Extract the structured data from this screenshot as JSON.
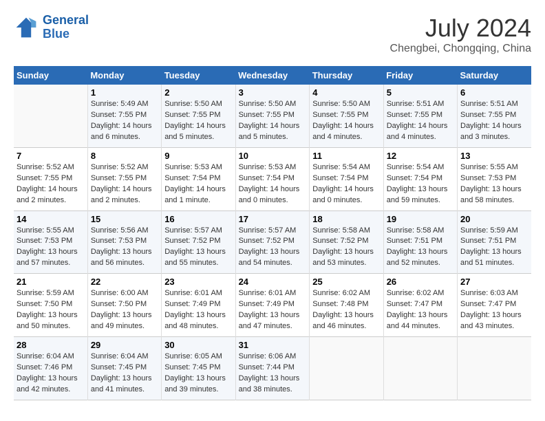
{
  "header": {
    "logo_line1": "General",
    "logo_line2": "Blue",
    "month_title": "July 2024",
    "location": "Chengbei, Chongqing, China"
  },
  "days_of_week": [
    "Sunday",
    "Monday",
    "Tuesday",
    "Wednesday",
    "Thursday",
    "Friday",
    "Saturday"
  ],
  "weeks": [
    [
      {
        "num": "",
        "sunrise": "",
        "sunset": "",
        "daylight": ""
      },
      {
        "num": "1",
        "sunrise": "Sunrise: 5:49 AM",
        "sunset": "Sunset: 7:55 PM",
        "daylight": "Daylight: 14 hours and 6 minutes."
      },
      {
        "num": "2",
        "sunrise": "Sunrise: 5:50 AM",
        "sunset": "Sunset: 7:55 PM",
        "daylight": "Daylight: 14 hours and 5 minutes."
      },
      {
        "num": "3",
        "sunrise": "Sunrise: 5:50 AM",
        "sunset": "Sunset: 7:55 PM",
        "daylight": "Daylight: 14 hours and 5 minutes."
      },
      {
        "num": "4",
        "sunrise": "Sunrise: 5:50 AM",
        "sunset": "Sunset: 7:55 PM",
        "daylight": "Daylight: 14 hours and 4 minutes."
      },
      {
        "num": "5",
        "sunrise": "Sunrise: 5:51 AM",
        "sunset": "Sunset: 7:55 PM",
        "daylight": "Daylight: 14 hours and 4 minutes."
      },
      {
        "num": "6",
        "sunrise": "Sunrise: 5:51 AM",
        "sunset": "Sunset: 7:55 PM",
        "daylight": "Daylight: 14 hours and 3 minutes."
      }
    ],
    [
      {
        "num": "7",
        "sunrise": "Sunrise: 5:52 AM",
        "sunset": "Sunset: 7:55 PM",
        "daylight": "Daylight: 14 hours and 2 minutes."
      },
      {
        "num": "8",
        "sunrise": "Sunrise: 5:52 AM",
        "sunset": "Sunset: 7:55 PM",
        "daylight": "Daylight: 14 hours and 2 minutes."
      },
      {
        "num": "9",
        "sunrise": "Sunrise: 5:53 AM",
        "sunset": "Sunset: 7:54 PM",
        "daylight": "Daylight: 14 hours and 1 minute."
      },
      {
        "num": "10",
        "sunrise": "Sunrise: 5:53 AM",
        "sunset": "Sunset: 7:54 PM",
        "daylight": "Daylight: 14 hours and 0 minutes."
      },
      {
        "num": "11",
        "sunrise": "Sunrise: 5:54 AM",
        "sunset": "Sunset: 7:54 PM",
        "daylight": "Daylight: 14 hours and 0 minutes."
      },
      {
        "num": "12",
        "sunrise": "Sunrise: 5:54 AM",
        "sunset": "Sunset: 7:54 PM",
        "daylight": "Daylight: 13 hours and 59 minutes."
      },
      {
        "num": "13",
        "sunrise": "Sunrise: 5:55 AM",
        "sunset": "Sunset: 7:53 PM",
        "daylight": "Daylight: 13 hours and 58 minutes."
      }
    ],
    [
      {
        "num": "14",
        "sunrise": "Sunrise: 5:55 AM",
        "sunset": "Sunset: 7:53 PM",
        "daylight": "Daylight: 13 hours and 57 minutes."
      },
      {
        "num": "15",
        "sunrise": "Sunrise: 5:56 AM",
        "sunset": "Sunset: 7:53 PM",
        "daylight": "Daylight: 13 hours and 56 minutes."
      },
      {
        "num": "16",
        "sunrise": "Sunrise: 5:57 AM",
        "sunset": "Sunset: 7:52 PM",
        "daylight": "Daylight: 13 hours and 55 minutes."
      },
      {
        "num": "17",
        "sunrise": "Sunrise: 5:57 AM",
        "sunset": "Sunset: 7:52 PM",
        "daylight": "Daylight: 13 hours and 54 minutes."
      },
      {
        "num": "18",
        "sunrise": "Sunrise: 5:58 AM",
        "sunset": "Sunset: 7:52 PM",
        "daylight": "Daylight: 13 hours and 53 minutes."
      },
      {
        "num": "19",
        "sunrise": "Sunrise: 5:58 AM",
        "sunset": "Sunset: 7:51 PM",
        "daylight": "Daylight: 13 hours and 52 minutes."
      },
      {
        "num": "20",
        "sunrise": "Sunrise: 5:59 AM",
        "sunset": "Sunset: 7:51 PM",
        "daylight": "Daylight: 13 hours and 51 minutes."
      }
    ],
    [
      {
        "num": "21",
        "sunrise": "Sunrise: 5:59 AM",
        "sunset": "Sunset: 7:50 PM",
        "daylight": "Daylight: 13 hours and 50 minutes."
      },
      {
        "num": "22",
        "sunrise": "Sunrise: 6:00 AM",
        "sunset": "Sunset: 7:50 PM",
        "daylight": "Daylight: 13 hours and 49 minutes."
      },
      {
        "num": "23",
        "sunrise": "Sunrise: 6:01 AM",
        "sunset": "Sunset: 7:49 PM",
        "daylight": "Daylight: 13 hours and 48 minutes."
      },
      {
        "num": "24",
        "sunrise": "Sunrise: 6:01 AM",
        "sunset": "Sunset: 7:49 PM",
        "daylight": "Daylight: 13 hours and 47 minutes."
      },
      {
        "num": "25",
        "sunrise": "Sunrise: 6:02 AM",
        "sunset": "Sunset: 7:48 PM",
        "daylight": "Daylight: 13 hours and 46 minutes."
      },
      {
        "num": "26",
        "sunrise": "Sunrise: 6:02 AM",
        "sunset": "Sunset: 7:47 PM",
        "daylight": "Daylight: 13 hours and 44 minutes."
      },
      {
        "num": "27",
        "sunrise": "Sunrise: 6:03 AM",
        "sunset": "Sunset: 7:47 PM",
        "daylight": "Daylight: 13 hours and 43 minutes."
      }
    ],
    [
      {
        "num": "28",
        "sunrise": "Sunrise: 6:04 AM",
        "sunset": "Sunset: 7:46 PM",
        "daylight": "Daylight: 13 hours and 42 minutes."
      },
      {
        "num": "29",
        "sunrise": "Sunrise: 6:04 AM",
        "sunset": "Sunset: 7:45 PM",
        "daylight": "Daylight: 13 hours and 41 minutes."
      },
      {
        "num": "30",
        "sunrise": "Sunrise: 6:05 AM",
        "sunset": "Sunset: 7:45 PM",
        "daylight": "Daylight: 13 hours and 39 minutes."
      },
      {
        "num": "31",
        "sunrise": "Sunrise: 6:06 AM",
        "sunset": "Sunset: 7:44 PM",
        "daylight": "Daylight: 13 hours and 38 minutes."
      },
      {
        "num": "",
        "sunrise": "",
        "sunset": "",
        "daylight": ""
      },
      {
        "num": "",
        "sunrise": "",
        "sunset": "",
        "daylight": ""
      },
      {
        "num": "",
        "sunrise": "",
        "sunset": "",
        "daylight": ""
      }
    ]
  ]
}
